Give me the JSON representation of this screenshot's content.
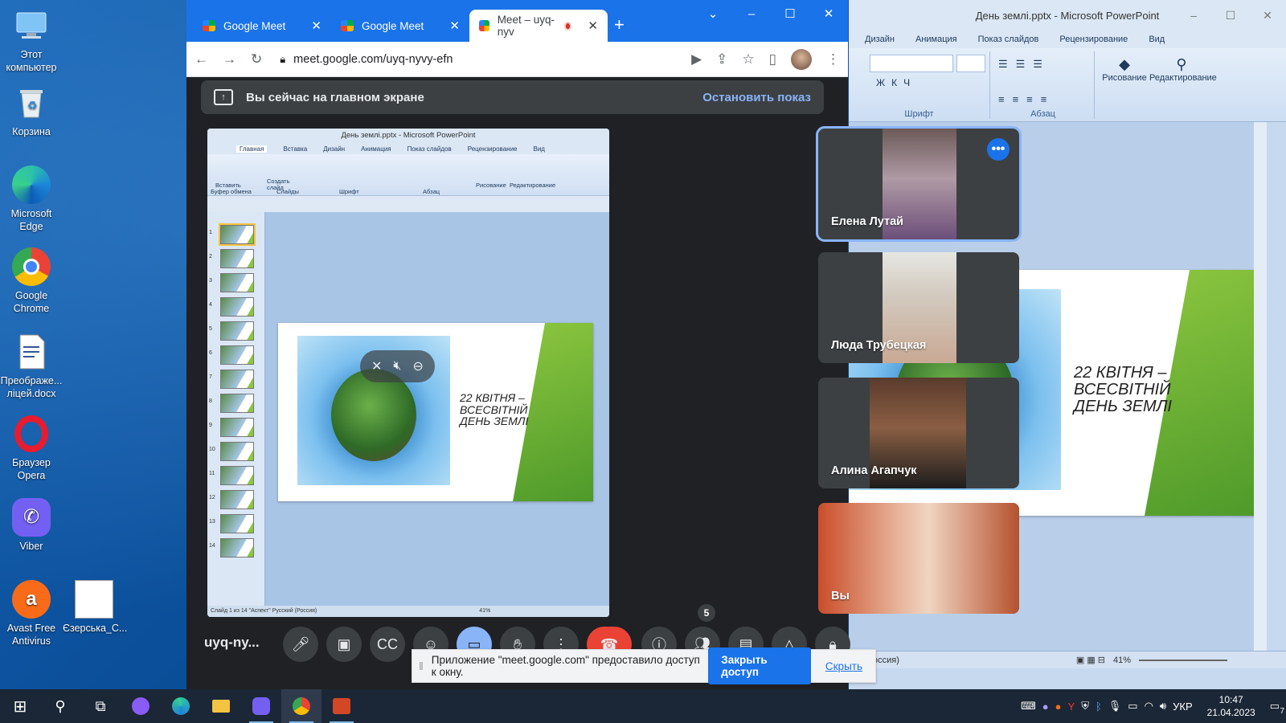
{
  "desktop": {
    "icons": [
      {
        "label": "Этот компьютер",
        "icon": "computer-icon"
      },
      {
        "label": "Корзина",
        "icon": "recycle-bin-icon"
      },
      {
        "label": "Microsoft Edge",
        "icon": "edge-icon"
      },
      {
        "label": "Google Chrome",
        "icon": "chrome-icon"
      },
      {
        "label": "Преображе... лiцей.docx",
        "icon": "word-doc-icon"
      },
      {
        "label": "Браузер Opera",
        "icon": "opera-icon"
      },
      {
        "label": "Viber",
        "icon": "viber-icon"
      },
      {
        "label": "Avast Free Antivirus",
        "icon": "avast-icon"
      },
      {
        "label": "Єзерська_С...",
        "icon": "image-file-icon"
      }
    ]
  },
  "powerpoint": {
    "title": "День землі.pptx - Microsoft PowerPoint",
    "tabs": [
      "Дизайн",
      "Анимация",
      "Показ слайдов",
      "Рецензирование",
      "Вид"
    ],
    "groups": {
      "font": "Шрифт",
      "paragraph": "Абзац",
      "drawing": "Рисование",
      "editing": "Редактирование"
    },
    "slide_text": [
      "22 КВІТНЯ –",
      "ВСЕСВІТНІЙ",
      "ДЕНЬ ЗЕМЛІ"
    ],
    "status_left": "оссия)",
    "zoom": "41%"
  },
  "chrome": {
    "tabs": [
      {
        "label": "Google Meet",
        "active": false
      },
      {
        "label": "Google Meet",
        "active": false
      },
      {
        "label": "Meet – uyq-nyv",
        "active": true
      }
    ],
    "url": "meet.google.com/uyq-nyvy-efn"
  },
  "meet": {
    "banner_text": "Вы сейчас на главном экране",
    "stop_label": "Остановить показ",
    "meeting_code": "uyq-ny...",
    "participants": [
      {
        "name": "Елена Лутай",
        "selected": true
      },
      {
        "name": "Люда Трубецкая",
        "selected": false
      },
      {
        "name": "Алина Агапчук",
        "selected": false
      },
      {
        "name": "Вы",
        "selected": false
      }
    ],
    "participant_count": "5"
  },
  "mini_ppt": {
    "title": "День землі.pptx - Microsoft PowerPoint",
    "tabs": [
      "Главная",
      "Вставка",
      "Дизайн",
      "Анимация",
      "Показ слайдов",
      "Рецензирование",
      "Вид"
    ],
    "ribbon": {
      "paste": "Вставить",
      "new_slide": "Создать слайд",
      "clipboard": "Буфер обмена",
      "slides": "Слайды",
      "font": "Шрифт",
      "paragraph": "Абзац",
      "drawing": "Рисование",
      "editing": "Редактирование"
    },
    "slide_numbers": [
      "1",
      "2",
      "3",
      "4",
      "5",
      "6",
      "7",
      "8",
      "9",
      "10",
      "11",
      "12",
      "13",
      "14"
    ],
    "status": "Слайд 1 из 14   \"Аспект\"   Русский (Россия)",
    "zoom": "41%"
  },
  "share_notice": {
    "text": "Приложение \"meet.google.com\" предоставило доступ к окну.",
    "close_label": "Закрыть доступ",
    "hide_label": "Скрыть"
  },
  "taskbar": {
    "language": "УКР",
    "time": "10:47",
    "date": "21.04.2023",
    "notifications": "7"
  }
}
